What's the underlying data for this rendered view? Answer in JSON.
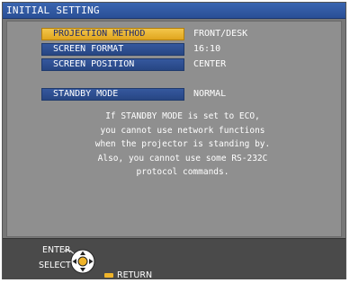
{
  "window": {
    "title": "INITIAL SETTING"
  },
  "menu": [
    {
      "label": "PROJECTION METHOD",
      "value": "FRONT/DESK",
      "selected": true
    },
    {
      "label": "SCREEN FORMAT",
      "value": "16:10",
      "selected": false
    },
    {
      "label": "SCREEN POSITION",
      "value": "CENTER",
      "selected": false
    },
    {
      "label": "STANDBY MODE",
      "value": "NORMAL",
      "selected": false
    }
  ],
  "message": {
    "lines": [
      "If STANDBY MODE is set to ECO,",
      "you cannot use network functions",
      "when the projector is standing by.",
      "Also, you cannot use some RS-232C",
      "protocol commands."
    ]
  },
  "footer": {
    "enter_label": "ENTER",
    "select_label": "SELECT",
    "return_label": "RETURN"
  },
  "colors": {
    "menu_blue": "#2f5196",
    "selected_yellow": "#e8b233",
    "panel_gray": "#8f8f8f",
    "footer_dark": "#4a4a4a"
  }
}
